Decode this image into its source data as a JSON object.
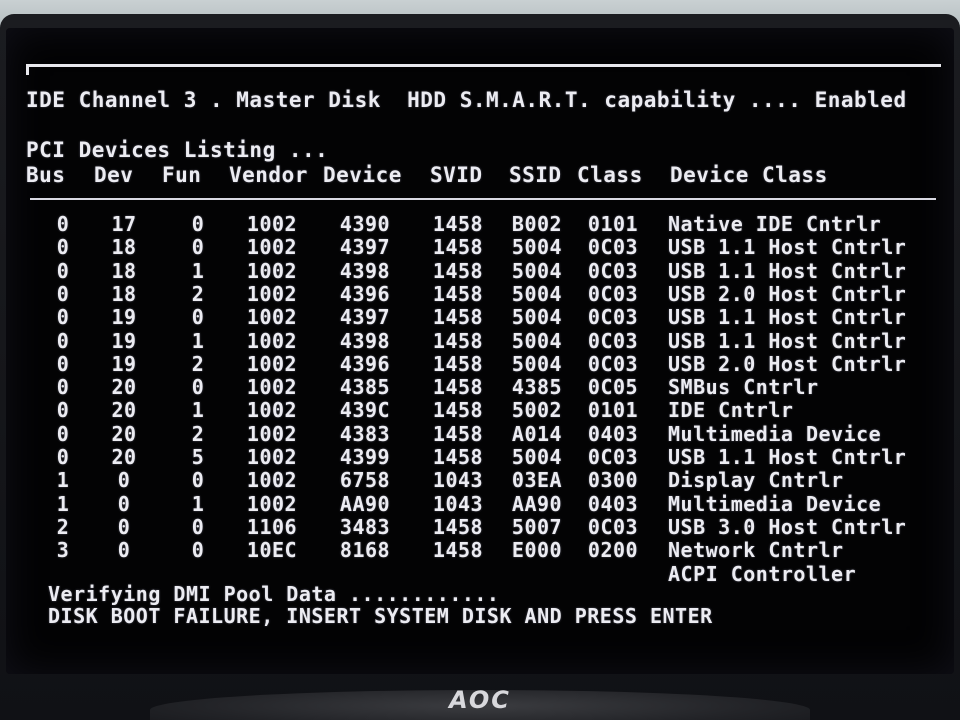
{
  "monitor": {
    "brand_logo": "AOC"
  },
  "bios": {
    "smart_line": "IDE Channel 3 . Master Disk  HDD S.M.A.R.T. capability .... Enabled",
    "pci_title": "PCI Devices Listing ...",
    "columns": [
      "Bus",
      "Dev",
      "Fun",
      "Vendor",
      "Device",
      "SVID",
      "SSID",
      "Class",
      "Device Class"
    ],
    "rows": [
      [
        "0",
        "17",
        "0",
        "1002",
        "4390",
        "1458",
        "B002",
        "0101",
        "Native IDE Cntrlr"
      ],
      [
        "0",
        "18",
        "0",
        "1002",
        "4397",
        "1458",
        "5004",
        "0C03",
        "USB 1.1 Host Cntrlr"
      ],
      [
        "0",
        "18",
        "1",
        "1002",
        "4398",
        "1458",
        "5004",
        "0C03",
        "USB 1.1 Host Cntrlr"
      ],
      [
        "0",
        "18",
        "2",
        "1002",
        "4396",
        "1458",
        "5004",
        "0C03",
        "USB 2.0 Host Cntrlr"
      ],
      [
        "0",
        "19",
        "0",
        "1002",
        "4397",
        "1458",
        "5004",
        "0C03",
        "USB 1.1 Host Cntrlr"
      ],
      [
        "0",
        "19",
        "1",
        "1002",
        "4398",
        "1458",
        "5004",
        "0C03",
        "USB 1.1 Host Cntrlr"
      ],
      [
        "0",
        "19",
        "2",
        "1002",
        "4396",
        "1458",
        "5004",
        "0C03",
        "USB 2.0 Host Cntrlr"
      ],
      [
        "0",
        "20",
        "0",
        "1002",
        "4385",
        "1458",
        "4385",
        "0C05",
        "SMBus Cntrlr"
      ],
      [
        "0",
        "20",
        "1",
        "1002",
        "439C",
        "1458",
        "5002",
        "0101",
        "IDE Cntrlr"
      ],
      [
        "0",
        "20",
        "2",
        "1002",
        "4383",
        "1458",
        "A014",
        "0403",
        "Multimedia Device"
      ],
      [
        "0",
        "20",
        "5",
        "1002",
        "4399",
        "1458",
        "5004",
        "0C03",
        "USB 1.1 Host Cntrlr"
      ],
      [
        "1",
        "0",
        "0",
        "1002",
        "6758",
        "1043",
        "03EA",
        "0300",
        "Display Cntrlr"
      ],
      [
        "1",
        "0",
        "1",
        "1002",
        "AA90",
        "1043",
        "AA90",
        "0403",
        "Multimedia Device"
      ],
      [
        "2",
        "0",
        "0",
        "1106",
        "3483",
        "1458",
        "5007",
        "0C03",
        "USB 3.0 Host Cntrlr"
      ],
      [
        "3",
        "0",
        "0",
        "10EC",
        "8168",
        "1458",
        "E000",
        "0200",
        "Network Cntrlr"
      ],
      [
        "",
        "",
        "",
        "",
        "",
        "",
        "",
        "",
        "ACPI Controller"
      ]
    ],
    "verify_line": "Verifying DMI Pool Data ............",
    "failure_line": "DISK BOOT FAILURE, INSERT SYSTEM DISK AND PRESS ENTER"
  },
  "colors": {
    "screen_bg": "#030304",
    "text": "#ececf2",
    "bezel": "#15161a"
  }
}
